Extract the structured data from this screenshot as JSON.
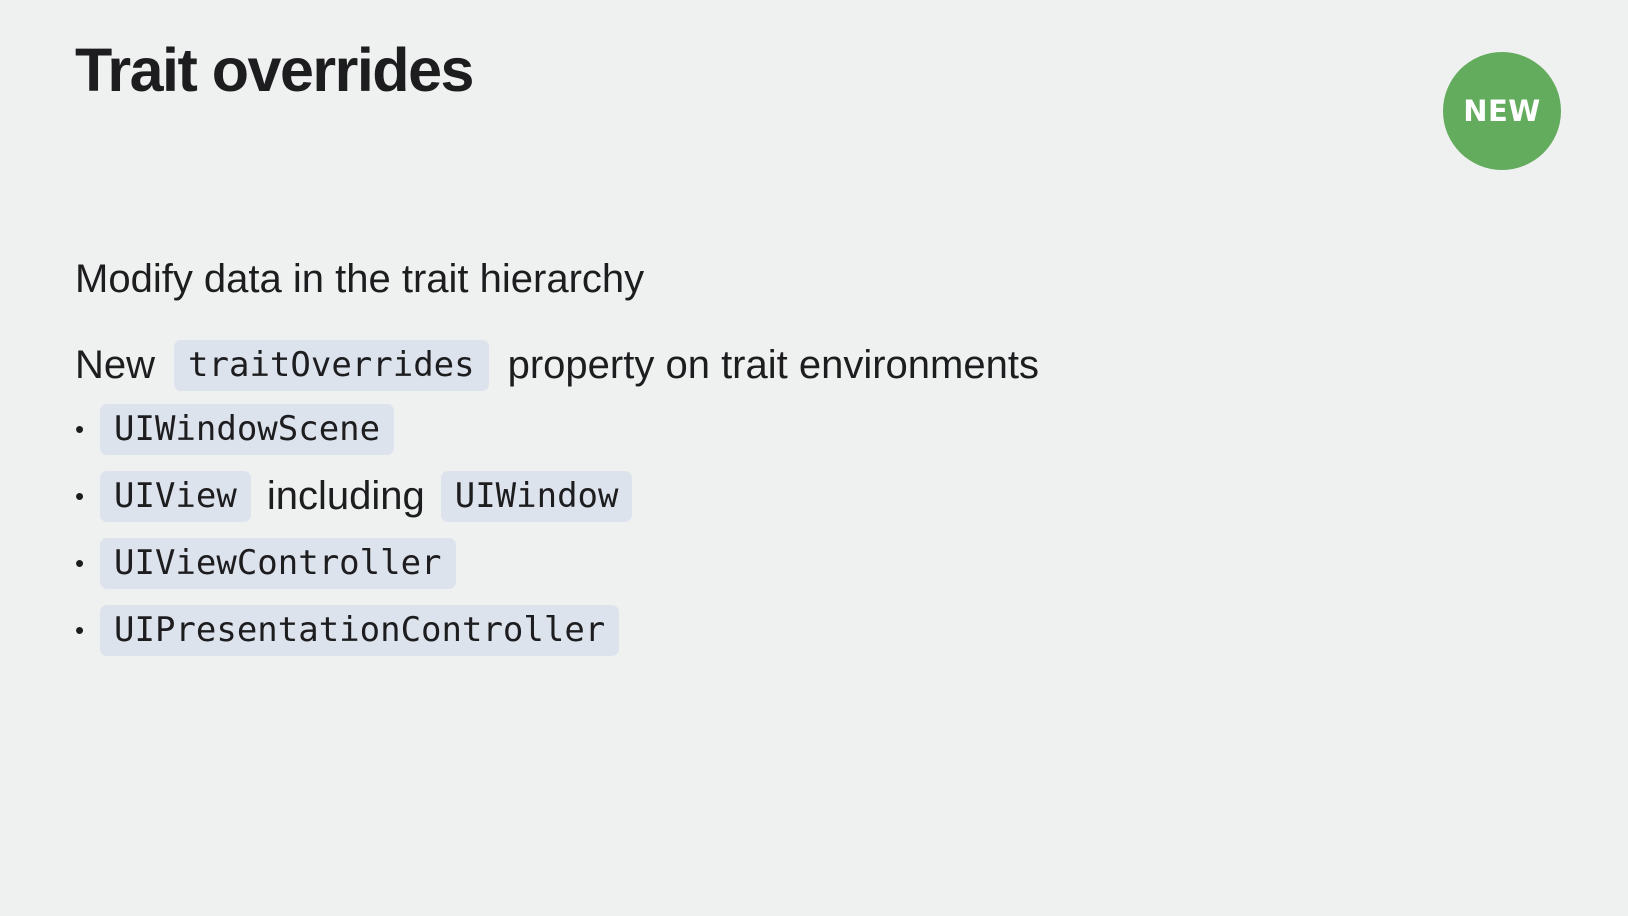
{
  "slide": {
    "title": "Trait overrides",
    "badge": "NEW",
    "line1": "Modify data in the trait hierarchy",
    "line2": {
      "prefix": "New",
      "code": "traitOverrides",
      "suffix": "property on trait environments"
    },
    "bullet_marker": "•",
    "bullets": [
      {
        "code": "UIWindowScene"
      },
      {
        "code": "UIView",
        "text": "including",
        "code2": "UIWindow"
      },
      {
        "code": "UIViewController"
      },
      {
        "code": "UIPresentationController"
      }
    ]
  },
  "colors": {
    "background": "#eff0f0",
    "badge": "#63ab5d",
    "code_background": "#dde3ed",
    "text": "#1d1d1f"
  }
}
